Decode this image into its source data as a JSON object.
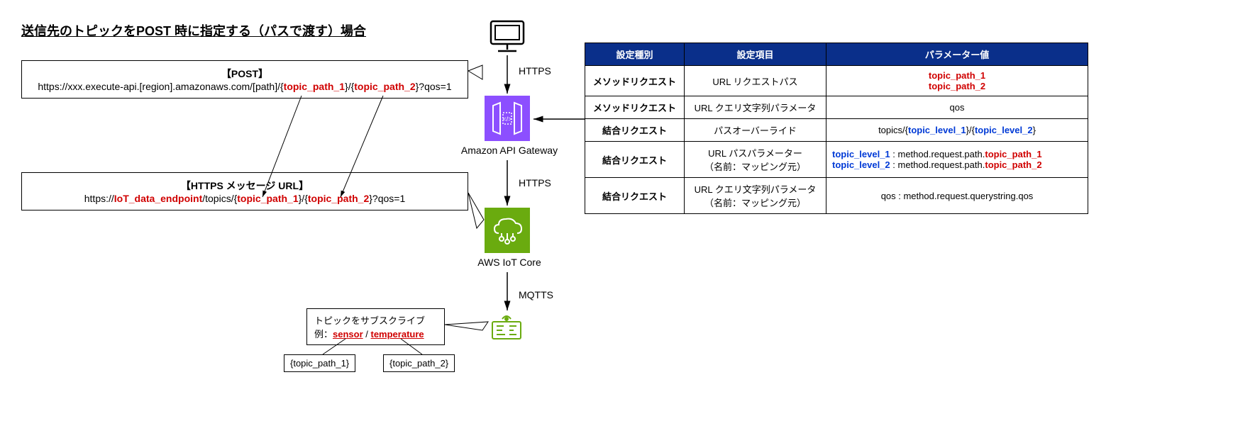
{
  "title": "送信先のトピックをPOST 時に指定する（パスで渡す）場合",
  "postBox": {
    "hdr": "【POST】",
    "pre": "https://xxx.execute-api.[region].amazonaws.com/[path]/{",
    "tp1": "topic_path_1",
    "mid": "}/{",
    "tp2": "topic_path_2",
    "suf": "}?qos=1"
  },
  "msgBox": {
    "hdr": "【HTTPS メッセージ URL】",
    "pre1": "https://",
    "ep": "IoT_data_endpoint",
    "pre2": "/topics/{",
    "tp1": "topic_path_1",
    "mid": "}/{",
    "tp2": "topic_path_2",
    "suf": "}?qos=1"
  },
  "subBox": {
    "l1": "トピックをサブスクライブ",
    "l2a": "例：",
    "sensor": "sensor",
    "slash": " / ",
    "temp": "temperature"
  },
  "tag1": "{topic_path_1}",
  "tag2": "{topic_path_2}",
  "proto": {
    "https1": "HTTPS",
    "https2": "HTTPS",
    "mqtts": "MQTTS"
  },
  "labels": {
    "apigw": "Amazon API Gateway",
    "iotcore": "AWS IoT Core"
  },
  "table": {
    "h1": "設定種別",
    "h2": "設定項目",
    "h3": "パラメーター値",
    "r1": {
      "c1": "メソッドリクエスト",
      "c2": "URL リクエストパス",
      "tp1": "topic_path_1",
      "tp2": "topic_path_2"
    },
    "r2": {
      "c1": "メソッドリクエスト",
      "c2": "URL クエリ文字列パラメータ",
      "c3": "qos"
    },
    "r3": {
      "c1": "結合リクエスト",
      "c2": "パスオーバーライド",
      "pre": "topics/{",
      "tl1": "topic_level_1",
      "mid": "}/{",
      "tl2": "topic_level_2",
      "suf": "}"
    },
    "r4": {
      "c1": "結合リクエスト",
      "c2a": "URL パスパラメーター",
      "c2b": "（名前：マッピング元）",
      "tl1": "topic_level_1",
      "sep": " : method.request.path.",
      "tp1": "topic_path_1",
      "tl2": "topic_level_2",
      "tp2": "topic_path_2"
    },
    "r5": {
      "c1": "結合リクエスト",
      "c2a": "URL クエリ文字列パラメータ",
      "c2b": "（名前：マッピング元）",
      "c3": "qos : method.request.querystring.qos"
    }
  }
}
